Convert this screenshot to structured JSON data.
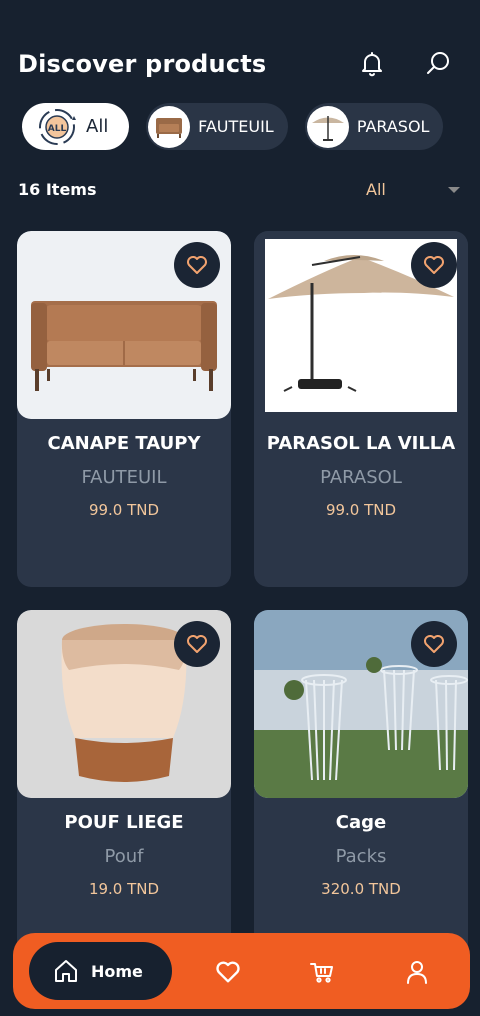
{
  "header": {
    "title": "Discover products",
    "icons": [
      "bell-icon",
      "search-icon"
    ]
  },
  "categories": [
    {
      "label": "All",
      "icon": "all-icon",
      "active": true
    },
    {
      "label": "FAUTEUIL",
      "icon": "armchair-thumbnail",
      "active": false
    },
    {
      "label": "PARASOL",
      "icon": "parasol-thumbnail",
      "active": false
    }
  ],
  "listing": {
    "count": "16 Items",
    "filter": "All"
  },
  "products": [
    {
      "name": "CANAPE TAUPY",
      "category": "FAUTEUIL",
      "price": "99.0 TND",
      "image": "sofa"
    },
    {
      "name": "PARASOL LA VILLA",
      "category": "PARASOL",
      "price": "99.0 TND",
      "image": "parasol"
    },
    {
      "name": "POUF LIEGE",
      "category": "Pouf",
      "price": "19.0 TND",
      "image": "pouf"
    },
    {
      "name": "Cage",
      "category": "Packs",
      "price": "320.0 TND",
      "image": "cage-tables"
    }
  ],
  "nav": {
    "home_label": "Home",
    "items": [
      "home-icon",
      "heart-icon",
      "cart-icon",
      "profile-icon"
    ]
  },
  "colors": {
    "background": "#17212f",
    "card": "#2b3648",
    "accent": "#f05d22",
    "price": "#f2c69b",
    "muted": "#8f9aa7"
  }
}
